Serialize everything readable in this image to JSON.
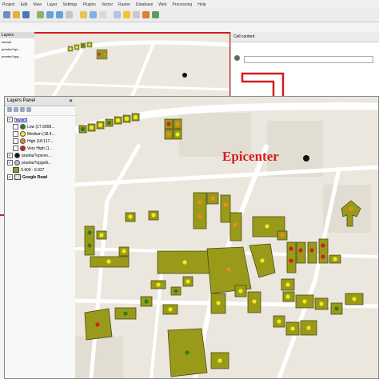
{
  "menubar": {
    "items": [
      "Project",
      "Edit",
      "View",
      "Layer",
      "Settings",
      "Plugins",
      "Vector",
      "Raster",
      "Database",
      "Web",
      "Processing",
      "Help"
    ]
  },
  "bg_sidebar": {
    "title": "Layers",
    "items": [
      "hazard",
      "prueba?opi...",
      "prueba?opg..."
    ]
  },
  "right_panel": {
    "title": "Cell content"
  },
  "layers_panel": {
    "title": "Layers Panel",
    "close_label": "✕",
    "layers": [
      {
        "name": "hazard",
        "checked": true
      },
      {
        "name": "Low (17.9999...",
        "color": "#2e7d1e",
        "symbol": "dot"
      },
      {
        "name": "Medium (18.4...",
        "color": "#f2ea1b",
        "symbol": "dot"
      },
      {
        "name": "High (18.117...",
        "color": "#f08a1a",
        "symbol": "dot"
      },
      {
        "name": "Very High (1...",
        "color": "#d21e1e",
        "symbol": "dot"
      },
      {
        "name": "prueba?opicen...",
        "color": "#111111",
        "symbol": "dot"
      },
      {
        "name": "prueba?opgolli...",
        "checked": true
      },
      {
        "name": "0.409 - 6.927",
        "color": "#9a9a1a",
        "symbol": "square"
      },
      {
        "name": "Google Road",
        "checked": true
      }
    ]
  },
  "map": {
    "epicenter_label": "Epicenter"
  },
  "colors": {
    "building_fill": "#9a9a1a",
    "low": "#2e7d1e",
    "medium": "#f2ea1b",
    "high": "#f08a1a",
    "very_high": "#d21e1e",
    "accent_red": "#d21e1e"
  }
}
